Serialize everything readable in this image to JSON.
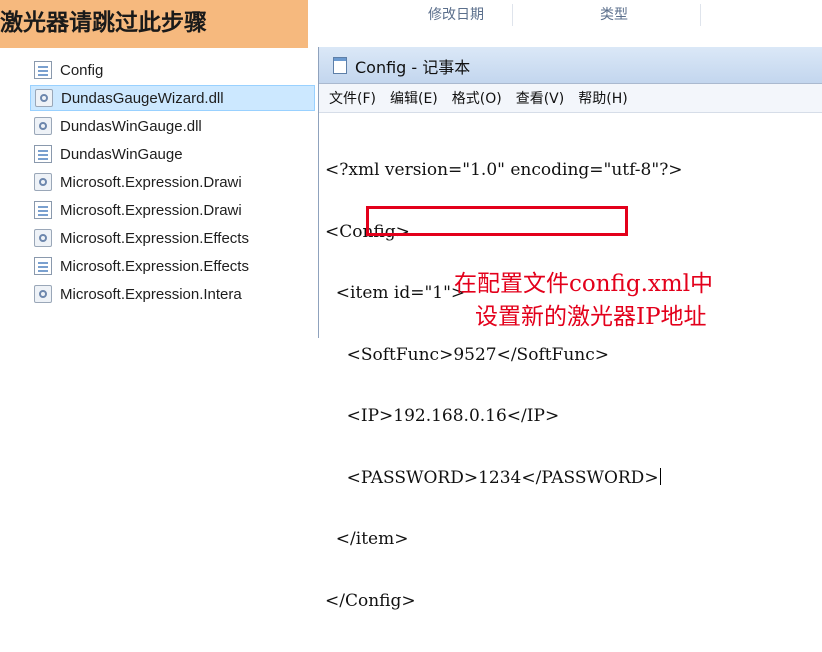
{
  "explorer": {
    "columns": [
      "修改日期",
      "类型"
    ],
    "files": [
      {
        "name": "Config",
        "icon": "config-file-icon",
        "selected": false
      },
      {
        "name": "DundasGaugeWizard.dll",
        "icon": "dll-file-icon",
        "selected": true
      },
      {
        "name": "DundasWinGauge.dll",
        "icon": "dll-file-icon",
        "selected": false
      },
      {
        "name": "DundasWinGauge",
        "icon": "config-file-icon",
        "selected": false
      },
      {
        "name": "Microsoft.Expression.Drawi",
        "icon": "dll-file-icon",
        "selected": false
      },
      {
        "name": "Microsoft.Expression.Drawi",
        "icon": "config-file-icon",
        "selected": false
      },
      {
        "name": "Microsoft.Expression.Effects",
        "icon": "dll-file-icon",
        "selected": false
      },
      {
        "name": "Microsoft.Expression.Effects",
        "icon": "config-file-icon",
        "selected": false
      },
      {
        "name": "Microsoft.Expression.Intera",
        "icon": "dll-file-icon",
        "selected": false
      }
    ]
  },
  "banner": {
    "text": "激光器请跳过此步骤",
    "color": "#f6b97e"
  },
  "notepad": {
    "title": "Config - 记事本",
    "menu": [
      "文件(F)",
      "编辑(E)",
      "格式(O)",
      "查看(V)",
      "帮助(H)"
    ],
    "lines": [
      "<?xml version=\"1.0\" encoding=\"utf-8\"?>",
      "<Config>",
      "  <item id=\"1\">",
      "    <SoftFunc>9527</SoftFunc>",
      "    <IP>192.168.0.16</IP>",
      "    <PASSWORD>1234</PASSWORD>",
      "  </item>",
      "</Config>"
    ]
  },
  "annotation": {
    "line1": "在配置文件config.xml中",
    "line2": "设置新的激光器IP地址",
    "color": "#e3001b"
  }
}
